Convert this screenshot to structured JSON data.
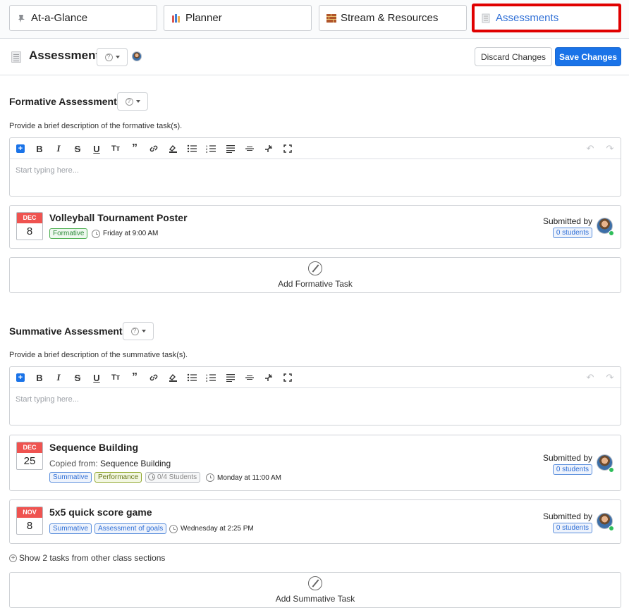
{
  "tabs": [
    {
      "label": "At-a-Glance",
      "icon": "pushpin-icon"
    },
    {
      "label": "Planner",
      "icon": "books-icon"
    },
    {
      "label": "Stream & Resources",
      "icon": "bricks-icon"
    },
    {
      "label": "Assessments",
      "icon": "document-icon",
      "active": true
    }
  ],
  "header": {
    "title": "Assessment",
    "discard_label": "Discard Changes",
    "save_label": "Save Changes",
    "help_glyph": "?"
  },
  "formative": {
    "title": "Formative Assessment",
    "prompt": "Provide a brief description of the formative task(s).",
    "placeholder": "Start typing here...",
    "tasks": [
      {
        "month": "DEC",
        "day": "8",
        "title": "Volleyball Tournament Poster",
        "tags": [
          "Formative"
        ],
        "due": "Friday at 9:00 AM",
        "submitted_label": "Submitted by",
        "students": "0 students"
      }
    ],
    "add_label": "Add Formative Task"
  },
  "summative": {
    "title": "Summative Assessment",
    "prompt": "Provide a brief description of the summative task(s).",
    "placeholder": "Start typing here...",
    "tasks": [
      {
        "month": "DEC",
        "day": "25",
        "title": "Sequence Building",
        "copied_prefix": "Copied from:",
        "copied_from": "Sequence Building",
        "tags": [
          "Summative",
          "Performance",
          "0/4 Students"
        ],
        "due": "Monday at 11:00 AM",
        "submitted_label": "Submitted by",
        "students": "0 students"
      },
      {
        "month": "NOV",
        "day": "8",
        "title": "5x5 quick score game",
        "tags": [
          "Summative",
          "Assessment of goals"
        ],
        "due": "Wednesday at 2:25 PM",
        "submitted_label": "Submitted by",
        "students": "0 students"
      }
    ],
    "show_other": "Show 2 tasks from other class sections",
    "add_label": "Add Summative Task"
  },
  "colors": {
    "accent": "#1a73e8",
    "active_tab_outline": "#e00000",
    "calendar_header": "#ef5350",
    "online": "#2ebd59"
  }
}
